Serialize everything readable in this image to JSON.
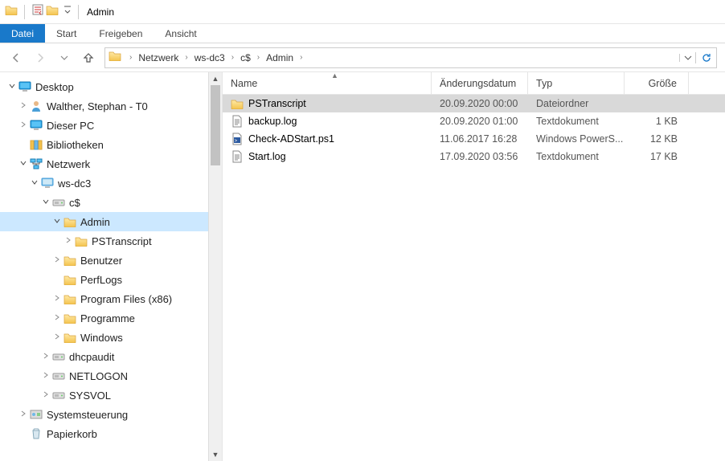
{
  "window_title": "Admin",
  "ribbon": {
    "file": "Datei",
    "home": "Start",
    "share": "Freigeben",
    "view": "Ansicht"
  },
  "breadcrumbs": [
    "Netzwerk",
    "ws-dc3",
    "c$",
    "Admin"
  ],
  "tree": [
    {
      "indent": 0,
      "exp": "open",
      "icon": "pc",
      "label": "Desktop"
    },
    {
      "indent": 1,
      "exp": "closed",
      "icon": "user",
      "label": "Walther, Stephan - T0"
    },
    {
      "indent": 1,
      "exp": "closed",
      "icon": "pc",
      "label": "Dieser PC"
    },
    {
      "indent": 1,
      "exp": "none",
      "icon": "lib",
      "label": "Bibliotheken"
    },
    {
      "indent": 1,
      "exp": "open",
      "icon": "net",
      "label": "Netzwerk"
    },
    {
      "indent": 2,
      "exp": "open",
      "icon": "computer",
      "label": "ws-dc3"
    },
    {
      "indent": 3,
      "exp": "open",
      "icon": "drive",
      "label": "c$"
    },
    {
      "indent": 4,
      "exp": "open",
      "icon": "folder",
      "label": "Admin",
      "sel": true
    },
    {
      "indent": 5,
      "exp": "closed",
      "icon": "folder",
      "label": "PSTranscript"
    },
    {
      "indent": 4,
      "exp": "closed",
      "icon": "folder",
      "label": "Benutzer"
    },
    {
      "indent": 4,
      "exp": "none",
      "icon": "folder",
      "label": "PerfLogs"
    },
    {
      "indent": 4,
      "exp": "closed",
      "icon": "folder",
      "label": "Program Files (x86)"
    },
    {
      "indent": 4,
      "exp": "closed",
      "icon": "folder",
      "label": "Programme"
    },
    {
      "indent": 4,
      "exp": "closed",
      "icon": "folder",
      "label": "Windows"
    },
    {
      "indent": 3,
      "exp": "closed",
      "icon": "drive",
      "label": "dhcpaudit"
    },
    {
      "indent": 3,
      "exp": "closed",
      "icon": "drive",
      "label": "NETLOGON"
    },
    {
      "indent": 3,
      "exp": "closed",
      "icon": "drive",
      "label": "SYSVOL"
    },
    {
      "indent": 1,
      "exp": "closed",
      "icon": "cp",
      "label": "Systemsteuerung"
    },
    {
      "indent": 1,
      "exp": "none2",
      "icon": "recycle",
      "label": "Papierkorb"
    }
  ],
  "columns": {
    "name": "Name",
    "date": "Änderungsdatum",
    "type": "Typ",
    "size": "Größe"
  },
  "rows": [
    {
      "icon": "folder",
      "name": "PSTranscript",
      "date": "20.09.2020 00:00",
      "type": "Dateiordner",
      "size": "",
      "sel": true
    },
    {
      "icon": "txt",
      "name": "backup.log",
      "date": "20.09.2020 01:00",
      "type": "Textdokument",
      "size": "1 KB"
    },
    {
      "icon": "ps",
      "name": "Check-ADStart.ps1",
      "date": "11.06.2017 16:28",
      "type": "Windows PowerS...",
      "size": "12 KB"
    },
    {
      "icon": "txt",
      "name": "Start.log",
      "date": "17.09.2020 03:56",
      "type": "Textdokument",
      "size": "17 KB"
    }
  ]
}
